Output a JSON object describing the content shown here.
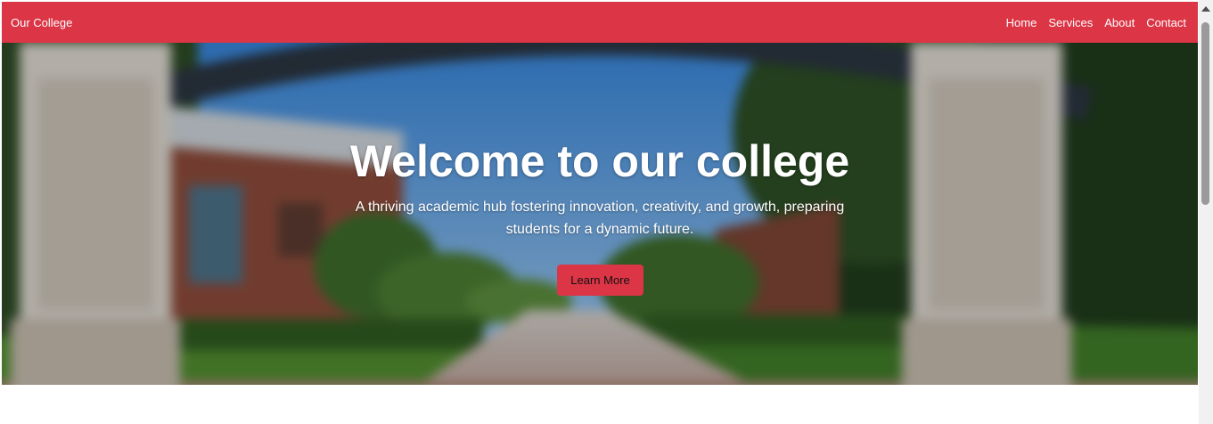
{
  "navbar": {
    "brand": "Our College",
    "links": [
      "Home",
      "Services",
      "About",
      "Contact"
    ]
  },
  "hero": {
    "title": "Welcome to our college",
    "subtitle": "A thriving academic hub fostering innovation, creativity, and growth, preparing students for a dynamic future.",
    "button_label": "Learn More"
  },
  "colors": {
    "brand_red": "#dc3545",
    "text_on_brand": "#ffffff",
    "button_text": "#111111"
  },
  "icons": {
    "scroll_up": "chevron-up-icon"
  }
}
